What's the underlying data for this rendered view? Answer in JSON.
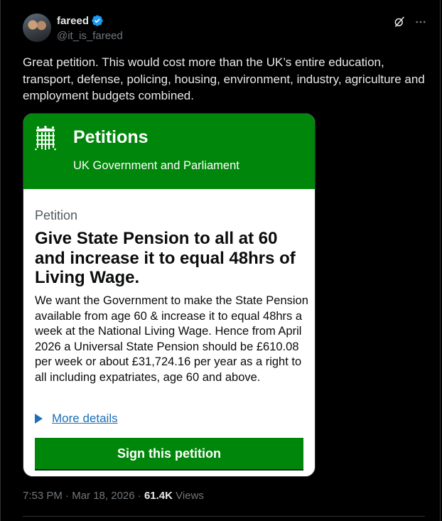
{
  "author": {
    "display_name": "fareed",
    "handle": "@it_is_fareed",
    "verified": true
  },
  "tweet": {
    "text": "Great petition. This would cost more than the UK’s entire education, transport, defense, policing, housing, environment, industry, agriculture and employment budgets combined."
  },
  "card": {
    "title": "Petitions",
    "subtitle": "UK Government and Parliament",
    "label": "Petition",
    "heading": "Give State Pension to all at 60 and increase it to equal 48hrs of Living Wage.",
    "body": "We want the Government to make the State Pension available from age 60 & increase it to equal 48hrs a week at the National Living Wage. Hence from April 2026 a Universal State Pension should be £610.08 per week or about £31,724.16 per year as a right to all including expatriates, age 60 and above.",
    "details_link": "More details",
    "button_label": "Sign this petition"
  },
  "meta": {
    "time": "7:53 PM",
    "separator": "·",
    "date": "Mar 18, 2026",
    "views_count": "61.4K",
    "views_label": "Views"
  },
  "colors": {
    "background": "#000000",
    "petition_green": "#00860a",
    "link_blue": "#1d70b8",
    "verified_blue": "#1d9bf0",
    "muted_text": "#71767b"
  },
  "icons": [
    "verified-badge-icon",
    "grok-icon",
    "more-options-icon",
    "portcullis-crest-icon",
    "disclosure-triangle-icon"
  ]
}
